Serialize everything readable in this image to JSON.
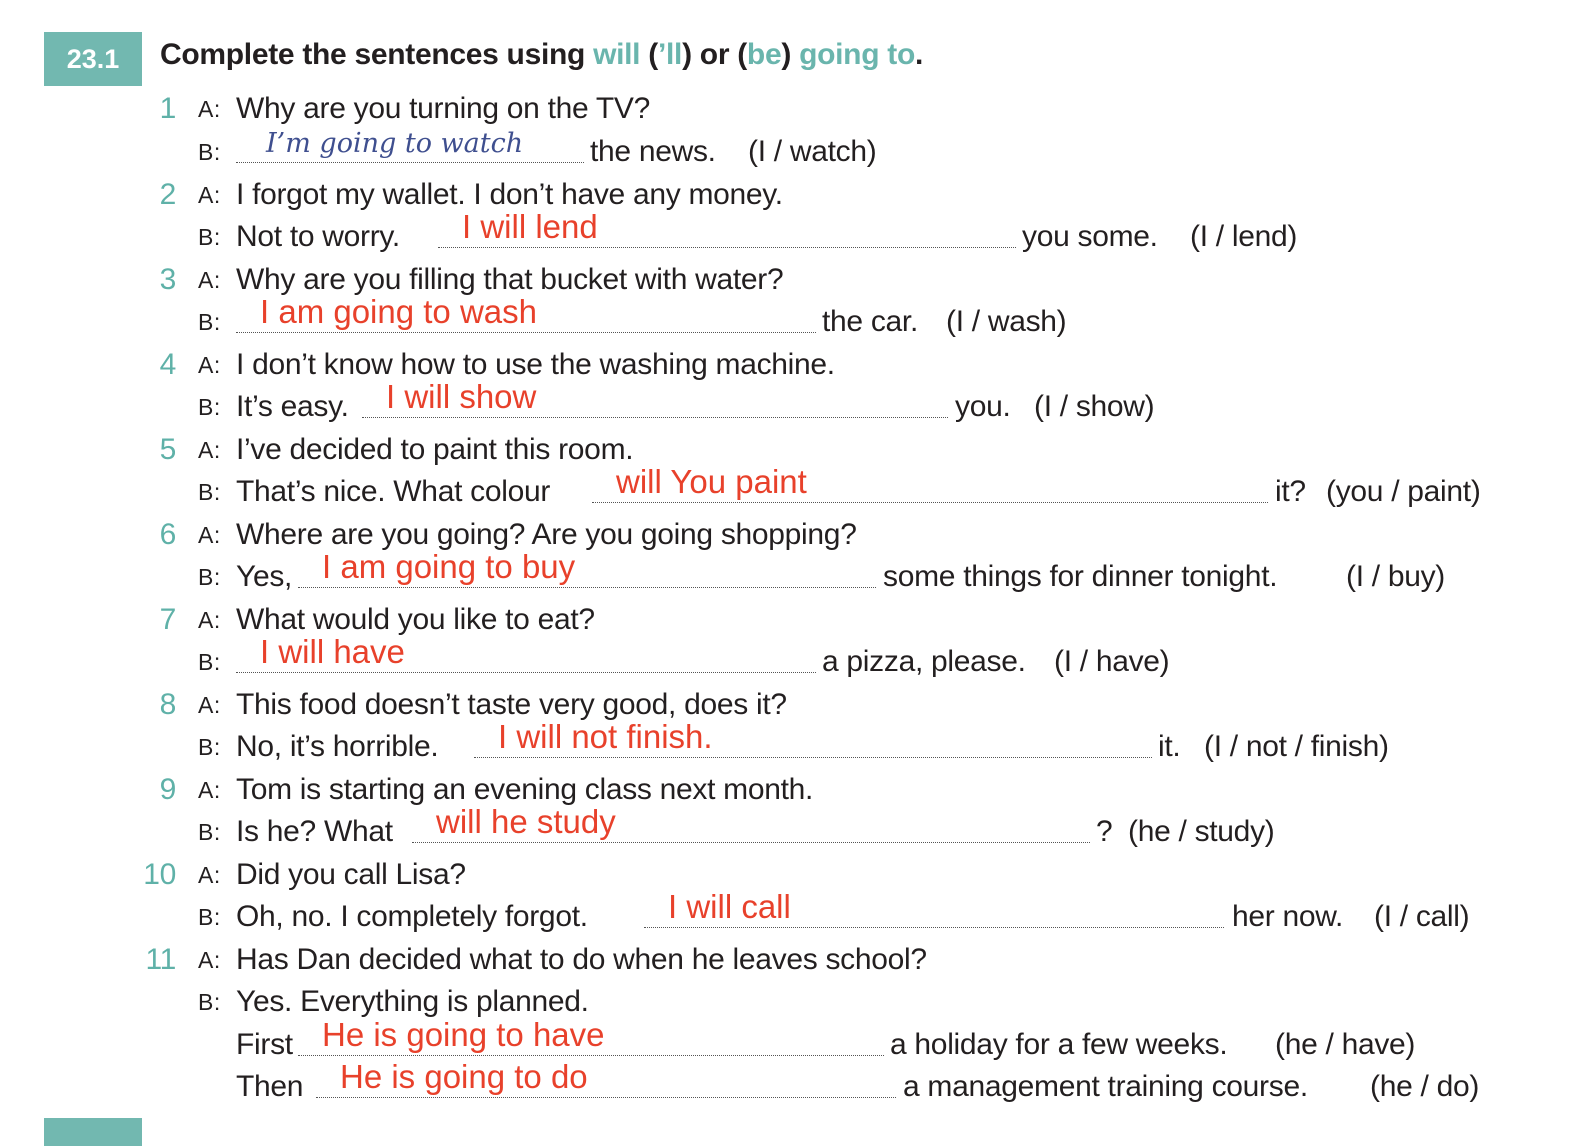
{
  "exercise": {
    "number": "23.1",
    "instruction": {
      "part1": "Complete the sentences using ",
      "will": "will",
      "part2": " (",
      "ll": "’ll",
      "part3": ") or (",
      "be": "be",
      "part4": ") ",
      "going_to": "going to",
      "part5": "."
    }
  },
  "items": [
    {
      "num": "1",
      "a_label": "A:",
      "a_text": "Why are you turning on the TV?",
      "b_label": "B:",
      "b_prefix": "",
      "answer": "I’m going to watch",
      "b_suffix": "the news.",
      "hint": "(I / watch)"
    },
    {
      "num": "2",
      "a_label": "A:",
      "a_text": "I forgot my wallet. I don’t have any money.",
      "b_label": "B:",
      "b_prefix": "Not to worry.",
      "answer": "I will lend",
      "b_suffix": "you some.",
      "hint": "(I / lend)"
    },
    {
      "num": "3",
      "a_label": "A:",
      "a_text": "Why are you filling that bucket with water?",
      "b_label": "B:",
      "b_prefix": "",
      "answer": "I am going to wash",
      "b_suffix": "the car.",
      "hint": "(I / wash)"
    },
    {
      "num": "4",
      "a_label": "A:",
      "a_text": "I don’t know how to use the washing machine.",
      "b_label": "B:",
      "b_prefix": "It’s easy.",
      "answer": "I will show",
      "b_suffix": "you.",
      "hint": "(I / show)"
    },
    {
      "num": "5",
      "a_label": "A:",
      "a_text": "I’ve decided to paint this room.",
      "b_label": "B:",
      "b_prefix": "That’s nice.  What colour",
      "answer": "will You paint",
      "b_suffix": "it?",
      "hint": "(you / paint)"
    },
    {
      "num": "6",
      "a_label": "A:",
      "a_text": "Where are you going?  Are you going shopping?",
      "b_label": "B:",
      "b_prefix": "Yes,",
      "answer": "I am going to buy",
      "b_suffix": "some things for dinner tonight.",
      "hint": "(I / buy)"
    },
    {
      "num": "7",
      "a_label": "A:",
      "a_text": "What would you like to eat?",
      "b_label": "B:",
      "b_prefix": "",
      "answer": "I will have",
      "b_suffix": "a pizza, please.",
      "hint": "(I / have)"
    },
    {
      "num": "8",
      "a_label": "A:",
      "a_text": "This food doesn’t taste very good, does it?",
      "b_label": "B:",
      "b_prefix": "No, it’s horrible.",
      "answer": "I will not finish.",
      "b_suffix": "it.",
      "hint": "(I / not / finish)"
    },
    {
      "num": "9",
      "a_label": "A:",
      "a_text": "Tom is starting an evening class next month.",
      "b_label": "B:",
      "b_prefix": "Is he?  What",
      "answer": "will he study",
      "b_suffix": "?",
      "hint": "(he / study)"
    },
    {
      "num": "10",
      "a_label": "A:",
      "a_text": "Did you call Lisa?",
      "b_label": "B:",
      "b_prefix": "Oh, no.  I completely forgot.",
      "answer": "I will call",
      "b_suffix": "her now.",
      "hint": "(I / call)"
    },
    {
      "num": "11",
      "a_label": "A:",
      "a_text": "Has Dan decided what to do when he leaves school?",
      "b_label": "B:",
      "b_prefix": "Yes.  Everything is planned.",
      "sub": [
        {
          "prefix": "First",
          "answer": "He is going to have",
          "suffix": "a holiday for a few weeks.",
          "hint": "(he / have)"
        },
        {
          "prefix": "Then",
          "answer": "He is going to do",
          "suffix": "a management training course.",
          "hint": "(he / do)"
        }
      ]
    }
  ]
}
